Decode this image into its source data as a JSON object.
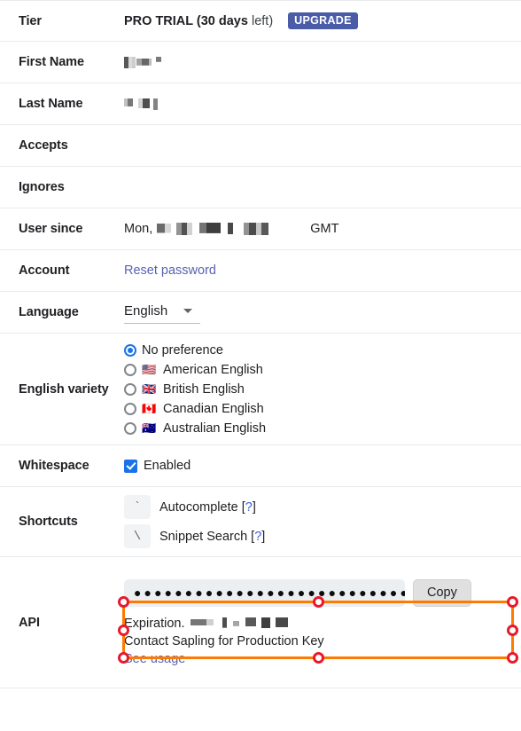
{
  "rows": {
    "tier": {
      "label": "Tier",
      "value_bold": "PRO TRIAL (30 days",
      "value_light": " left)",
      "upgrade_label": "UPGRADE"
    },
    "first_name": {
      "label": "First Name",
      "value": ""
    },
    "last_name": {
      "label": "Last Name",
      "value": ""
    },
    "accepts": {
      "label": "Accepts",
      "value": ""
    },
    "ignores": {
      "label": "Ignores",
      "value": ""
    },
    "user_since": {
      "label": "User since",
      "prefix": "Mon,",
      "suffix": "GMT"
    },
    "account": {
      "label": "Account",
      "reset_password_link": "Reset password"
    },
    "language": {
      "label": "Language",
      "selected": "English",
      "caret_icon": "chevron-down-icon"
    },
    "english_variety": {
      "label": "English variety",
      "options": [
        {
          "label": "No preference",
          "flag": "",
          "selected": true
        },
        {
          "label": "American English",
          "flag": "🇺🇸",
          "selected": false
        },
        {
          "label": "British English",
          "flag": "🇬🇧",
          "selected": false
        },
        {
          "label": "Canadian English",
          "flag": "🇨🇦",
          "selected": false
        },
        {
          "label": "Australian English",
          "flag": "🇦🇺",
          "selected": false
        }
      ]
    },
    "whitespace": {
      "label": "Whitespace",
      "checkbox_label": "Enabled",
      "checked": true
    },
    "shortcuts": {
      "label": "Shortcuts",
      "items": [
        {
          "key": "`",
          "label": "Autocomplete",
          "help": "?"
        },
        {
          "key": "\\",
          "label": "Snippet Search",
          "help": "?"
        }
      ]
    },
    "api": {
      "label": "API",
      "key_masked": "●●●●●●●●●●●●●●●●●●●●●●●●●●●●●●●●●●●●●",
      "copy_label": "Copy",
      "expiration_label": "Expiration.",
      "production_key_line": "Contact Sapling for Production Key",
      "see_usage_link": "See usage"
    }
  },
  "colors": {
    "accent_blue": "#1a73e8",
    "link_blue": "#5663b4",
    "upgrade_badge_bg": "#4a5ba8",
    "selection_orange": "#ff7a00",
    "handle_red": "#e8192c",
    "row_divider": "#e8eaed"
  }
}
